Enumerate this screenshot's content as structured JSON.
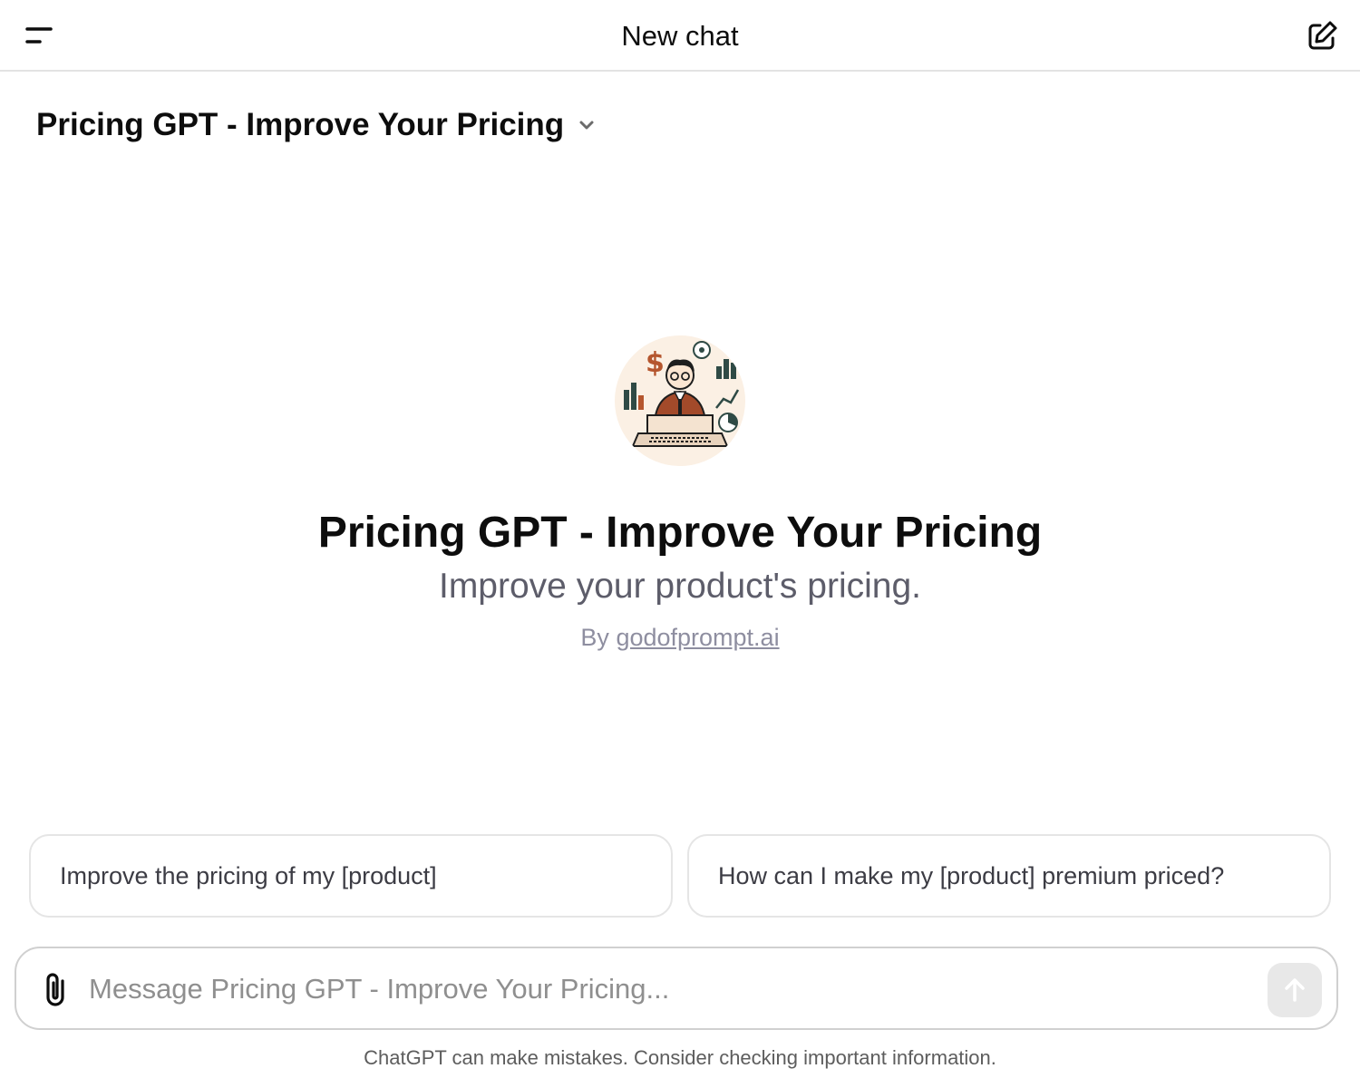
{
  "header": {
    "title": "New chat",
    "menu_icon": "menu-icon",
    "new_chat_icon": "compose-icon"
  },
  "model_selector": {
    "label": "Pricing GPT - Improve Your Pricing",
    "chevron_icon": "chevron-down-icon"
  },
  "gpt": {
    "avatar_icon": "gpt-avatar-illustration",
    "title": "Pricing GPT - Improve Your Pricing",
    "description": "Improve your product's pricing.",
    "author_prefix": "By",
    "author_link": "godofprompt.ai"
  },
  "conversation_starters": [
    {
      "label": "Improve the pricing of my [product]"
    },
    {
      "label": "How can I make my [product] premium priced?"
    }
  ],
  "composer": {
    "placeholder": "Message Pricing GPT - Improve Your Pricing...",
    "value": "",
    "attach_icon": "paperclip-icon",
    "send_icon": "arrow-up-icon"
  },
  "footer": {
    "disclaimer": "ChatGPT can make mistakes. Consider checking important information."
  },
  "colors": {
    "border": "#e3e3e3",
    "text_primary": "#0d0d0d",
    "text_secondary": "#5d5d6a",
    "text_muted": "#8e8ea0",
    "send_disabled": "#e8e8e8"
  }
}
